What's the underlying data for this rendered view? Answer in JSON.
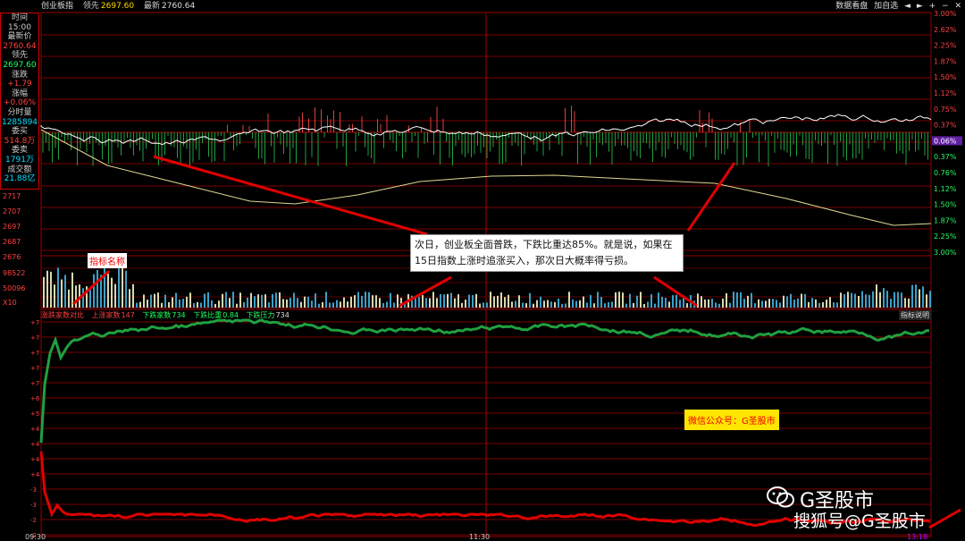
{
  "topbar": {
    "name": "创业板指",
    "lead_label": "领先",
    "lead_value": "2697.60",
    "latest_label": "最新",
    "latest_value": "2760.64",
    "menu_data": "数据看盘",
    "menu_add": "加自选",
    "btn_left": "◄",
    "btn_right": "►",
    "btn_plus": "+",
    "btn_minus": "−",
    "btn_close": "✕"
  },
  "info": {
    "time_label": "时间",
    "time_value": "15:00",
    "price_label": "最新价",
    "price_value": "2760.64",
    "lead_label": "领先",
    "lead_value": "2697.60",
    "chg_label": "涨跌",
    "chg_value": "+1.79",
    "pct_label": "涨幅",
    "pct_value": "+0.06%",
    "vol_label": "分时量",
    "vol_value": "1285894",
    "buy_label": "委买",
    "buy_value": "514.8万",
    "sell_label": "委卖",
    "sell_value": "1791万",
    "amt_label": "成交额",
    "amt_value": "21.88亿"
  },
  "price_axis": {
    "left": [
      "2717",
      "2707",
      "2697",
      "2687",
      "2676"
    ],
    "right": [
      "3.00%",
      "2.62%",
      "2.25%",
      "1.87%",
      "1.50%",
      "1.12%",
      "0.75%",
      "0.37%",
      "0.06%",
      "0.37%",
      "0.76%",
      "1.12%",
      "1.50%",
      "1.87%",
      "2.25%",
      "3.00%"
    ]
  },
  "vol_axis": {
    "labels": [
      "98522",
      "50096",
      "X10"
    ]
  },
  "indicator": {
    "name": "涨跌家数对比",
    "up_label": "上涨家数",
    "up_value": "147",
    "down_label": "下跌家数",
    "down_value": "734",
    "ratio_label": "下跌比重",
    "ratio_value": "0.84",
    "pressure_label": "下跌压力",
    "pressure_value": "734",
    "button": "指标说明"
  },
  "ind_axis": [
    "+7",
    "+7",
    "+7",
    "+7",
    "+7",
    "+6",
    "+5",
    "+4",
    "+4",
    "+4",
    "+4",
    "-3",
    "-3",
    "-2",
    "-2"
  ],
  "annotation": "次日，创业板全面普跌，下跌比重达85%。就是说，如果在15日指数上涨时追涨买入，那次日大概率得亏损。",
  "tag_indicator": "指标名称",
  "tag_wechat": "微信公众号：G圣股市",
  "watermark1": "G圣股市",
  "watermark2": "搜狐号@G圣股市",
  "times": {
    "start": "09:30",
    "mid": "11:30",
    "end": "13:18"
  },
  "colors": {
    "red": "#e00000",
    "green": "#20a040",
    "white": "#ffffff",
    "yellow": "#e0d890",
    "grid": "#8b0000"
  }
}
